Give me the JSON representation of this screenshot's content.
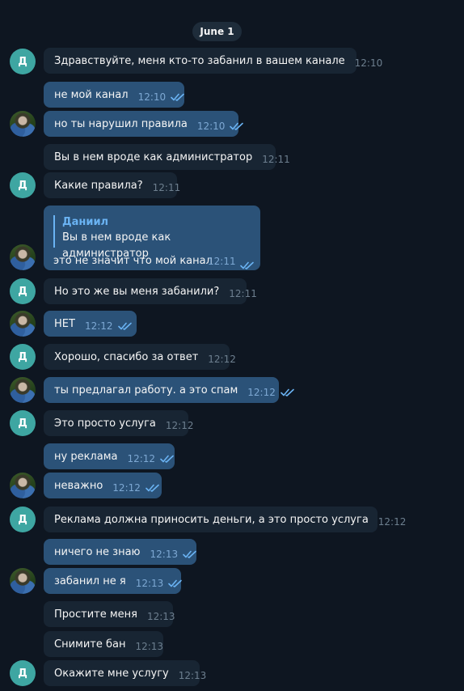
{
  "date_separator": "June 1",
  "avatar_letter": "Д",
  "messages": [
    {
      "text": "Здравствуйте, меня кто-то забанил в вашем канале",
      "time": "12:10"
    },
    {
      "text": "не мой канал",
      "time": "12:10"
    },
    {
      "text": "но ты нарушил правила",
      "time": "12:10"
    },
    {
      "text": "Вы в нем вроде как администратор",
      "time": "12:11"
    },
    {
      "text": "Какие правила?",
      "time": "12:11"
    },
    {
      "text": "это не значит что мой канал",
      "time": "12:11",
      "reply_name": "Даниил",
      "reply_text": "Вы в нем вроде как администратор"
    },
    {
      "text": "Но это же вы меня забанили?",
      "time": "12:11"
    },
    {
      "text": "НЕТ",
      "time": "12:12"
    },
    {
      "text": "Хорошо, спасибо за ответ",
      "time": "12:12"
    },
    {
      "text": "ты предлагал работу. а это спам",
      "time": "12:12"
    },
    {
      "text": "Это просто услуга",
      "time": "12:12"
    },
    {
      "text": "ну реклама",
      "time": "12:12"
    },
    {
      "text": "неважно",
      "time": "12:12"
    },
    {
      "text": "Реклама должна приносить деньги, а это просто услуга",
      "time": "12:12"
    },
    {
      "text": "ничего не знаю",
      "time": "12:13"
    },
    {
      "text": "забанил не я",
      "time": "12:13"
    },
    {
      "text": "Простите меня",
      "time": "12:13"
    },
    {
      "text": "Снимите бан",
      "time": "12:13"
    },
    {
      "text": "Окажите мне услугу",
      "time": "12:13"
    }
  ]
}
